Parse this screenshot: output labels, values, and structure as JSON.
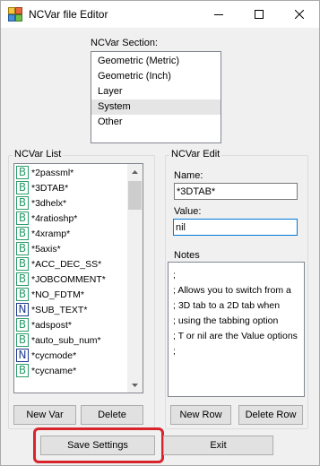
{
  "window": {
    "title": "NCVar file Editor"
  },
  "section": {
    "label": "NCVar Section:",
    "items": [
      "Geometric (Metric)",
      "Geometric (Inch)",
      "Layer",
      "System",
      "Other"
    ],
    "selected": "System"
  },
  "var_list": {
    "group_title": "NCVar List",
    "items": [
      {
        "name": "*2passml*",
        "type": "B"
      },
      {
        "name": "*3DTAB*",
        "type": "B"
      },
      {
        "name": "*3dhelx*",
        "type": "B"
      },
      {
        "name": "*4ratioshp*",
        "type": "B"
      },
      {
        "name": "*4xramp*",
        "type": "B"
      },
      {
        "name": "*5axis*",
        "type": "B"
      },
      {
        "name": "*ACC_DEC_SS*",
        "type": "B"
      },
      {
        "name": "*JOBCOMMENT*",
        "type": "B"
      },
      {
        "name": "*NO_FDTM*",
        "type": "B"
      },
      {
        "name": "*SUB_TEXT*",
        "type": "N"
      },
      {
        "name": "*adspost*",
        "type": "B"
      },
      {
        "name": "*auto_sub_num*",
        "type": "B"
      },
      {
        "name": "*cycmode*",
        "type": "N"
      },
      {
        "name": "*cycname*",
        "type": "B"
      }
    ],
    "scroll_fraction": 0.0,
    "new_label": "New Var",
    "delete_label": "Delete"
  },
  "edit": {
    "group_title": "NCVar Edit",
    "name_label": "Name:",
    "name_value": "*3DTAB*",
    "value_label": "Value:",
    "value_value": "nil",
    "notes_label": "Notes",
    "notes_lines": [
      ";",
      "; Allows you to switch from a",
      "; 3D tab to a 2D tab when",
      "; using the tabbing option",
      "; T or nil are the Value options",
      ";"
    ],
    "new_row_label": "New Row",
    "delete_row_label": "Delete Row"
  },
  "footer": {
    "save_label": "Save Settings",
    "exit_label": "Exit"
  },
  "colors": {
    "highlight": "#d7252b",
    "b_icon": "#2a9d6a",
    "n_icon": "#1f3a8f"
  }
}
